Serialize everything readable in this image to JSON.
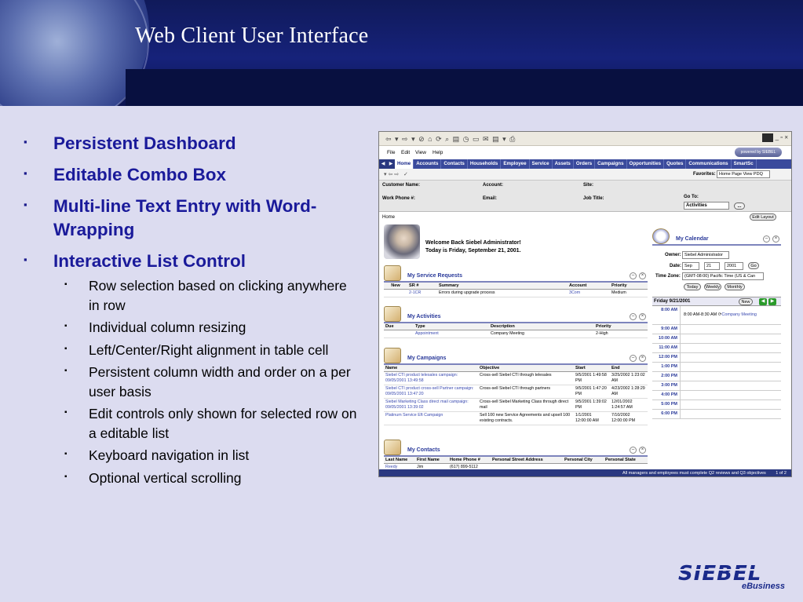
{
  "slide": {
    "title": "Web Client User Interface",
    "bullets": [
      "Persistent Dashboard",
      "Editable Combo Box",
      "Multi-line Text Entry with Word-Wrapping",
      "Interactive List Control"
    ],
    "sub_bullets": [
      "Row selection based on clicking anywhere in row",
      "Individual column resizing",
      "Left/Center/Right alignment in table cell",
      "Persistent column width and order on a per user basis",
      "Edit controls only shown for selected row on a editable list",
      "Keyboard navigation in list",
      "Optional vertical scrolling"
    ],
    "bullet_mark": "▪",
    "logo": {
      "word": "SIEBEL",
      "sub": "eBusiness"
    },
    "colors": {
      "header": "#16227a",
      "background": "#dcdcf0",
      "bullet_text": "#1a1a9a"
    }
  },
  "app": {
    "toolbar_icons": "⇦ ▾ ⇨ ▾ ⊘ ⌂ ⟳ ⌕ ▤ ◷ ▭ ✉ ▤ ▾ ⎙",
    "window_controls": "_ ▫ ×",
    "menu": [
      "File",
      "Edit",
      "View",
      "Help"
    ],
    "brand": "powered by SIEBEL",
    "tabs": [
      "Home",
      "Accounts",
      "Contacts",
      "Households",
      "Employee",
      "Service",
      "Assets",
      "Orders",
      "Campaigns",
      "Opportunities",
      "Quotes",
      "Communications",
      "SmartSc"
    ],
    "tab_arrows": [
      "◀",
      "▶"
    ],
    "favorites_label": "Favorites:",
    "favorites_value": "Home Page View PDQ",
    "customer": {
      "name_label": "Customer Name:",
      "account_label": "Account:",
      "site_label": "Site:",
      "phone_label": "Work Phone #:",
      "email_label": "Email:",
      "job_label": "Job Title:",
      "goto_label": "Go To:",
      "goto_value": "Activities",
      "goto_btn": "..."
    },
    "breadcrumb": "Home",
    "edit_layout": "Edit Layout",
    "welcome": [
      "Welcome Back Siebel Administrator!",
      "Today is Friday, September 21, 2001."
    ],
    "service_requests": {
      "title": "My Service Requests",
      "columns": [
        "New",
        "SR #",
        "Summary",
        "Account",
        "Priority"
      ],
      "rows": [
        [
          "",
          "2-1CR",
          "Errors during upgrade process",
          "3Com",
          "Medium"
        ]
      ]
    },
    "activities": {
      "title": "My Activities",
      "columns": [
        "Due",
        "Type",
        "Description",
        "Priority"
      ],
      "rows": [
        [
          "",
          "Appointment",
          "Company Meeting",
          "2-High"
        ]
      ]
    },
    "campaigns": {
      "title": "My Campaigns",
      "columns": [
        "Name",
        "Objective",
        "Start",
        "End"
      ],
      "rows": [
        [
          "Siebel CTI product telesales campaign: 09/05/2001 13:49:58",
          "Cross-sell Siebel CTI through telesales",
          "9/5/2001 1:49:58 PM",
          "3/25/2002 1:23:02 AM"
        ],
        [
          "Siebel CTI product cross-sell Partner campaign: 09/05/2001 13:47:20",
          "Cross-sell Siebel CTI through partners",
          "9/5/2001 1:47:20 PM",
          "4/23/2002 1:28:29 AM"
        ],
        [
          "Siebel Marketing Class direct mail campaign: 09/05/2001 13:39:02",
          "Cross-sell Siebel Marketing Class through direct mail",
          "9/5/2001 1:39:02 PM",
          "12/01/2002 1:24:57 AM"
        ],
        [
          "Platinum Service Eft Campaign",
          "Sell 100 new Service Agreements and upsell 100 existing contracts.",
          "1/1/2001 12:00:00 AM",
          "7/10/2002 12:00:00 PM"
        ]
      ]
    },
    "contacts": {
      "title": "My Contacts",
      "columns": [
        "Last Name",
        "First Name",
        "Home Phone #",
        "Personal Street Address",
        "Personal City",
        "Personal State"
      ],
      "rows": [
        [
          "Reedy",
          "Jim",
          "(617) 899-5112",
          "",
          "",
          ""
        ]
      ]
    },
    "calendar": {
      "title": "My Calendar",
      "owner_label": "Owner:",
      "owner_value": "Siebel Administrator",
      "date_label": "Date:",
      "month": "Sep",
      "day": "21",
      "year": "2001",
      "go": "Go",
      "tz_label": "Time Zone:",
      "tz_value": "(GMT-08:00) Pacific Time (US & Can",
      "views": [
        "Today",
        "Weekly",
        "Monthly"
      ],
      "day_label": "Friday 9/21/2001",
      "new_btn": "New",
      "slots": [
        "8:00 AM",
        "9:00 AM",
        "10:00 AM",
        "11:00 AM",
        "12:00 PM",
        "1:00 PM",
        "2:00 PM",
        "3:00 PM",
        "4:00 PM",
        "5:00 PM",
        "6:00 PM"
      ],
      "event_time": "8:00 AM-8:30 AM",
      "event_name": "Company Meeting"
    },
    "status": {
      "message": "All managers and employees must complete Q2 reviews and Q3 objectives",
      "page": "1 of 2"
    }
  }
}
